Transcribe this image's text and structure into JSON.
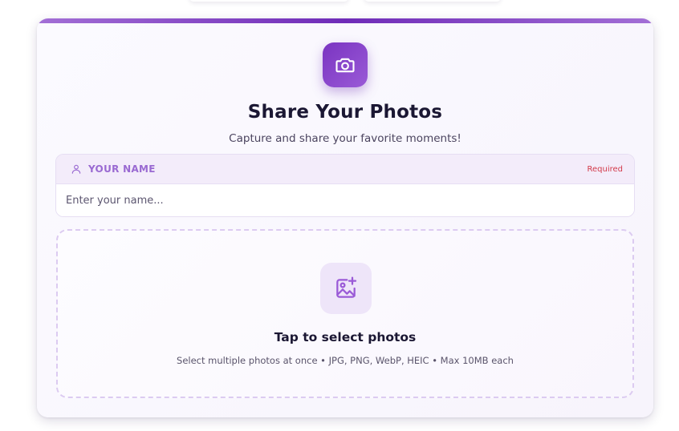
{
  "card": {
    "title": "Share Your Photos",
    "subtitle": "Capture and share your favorite moments!",
    "icon": "camera-icon",
    "accent_color": "#7b33c2"
  },
  "name_field": {
    "label": "YOUR NAME",
    "required_text": "Required",
    "placeholder": "Enter your name...",
    "value": "",
    "icon": "user-icon"
  },
  "upload": {
    "title": "Tap to select photos",
    "hint": "Select multiple photos at once • JPG, PNG, WebP, HEIC • Max 10MB each",
    "icon": "image-add-icon"
  },
  "colors": {
    "brand_purple": "#7b33c2",
    "label_purple": "#9a6ad2",
    "required_red": "#d33a4a",
    "dashed_border": "#dccbf1"
  }
}
